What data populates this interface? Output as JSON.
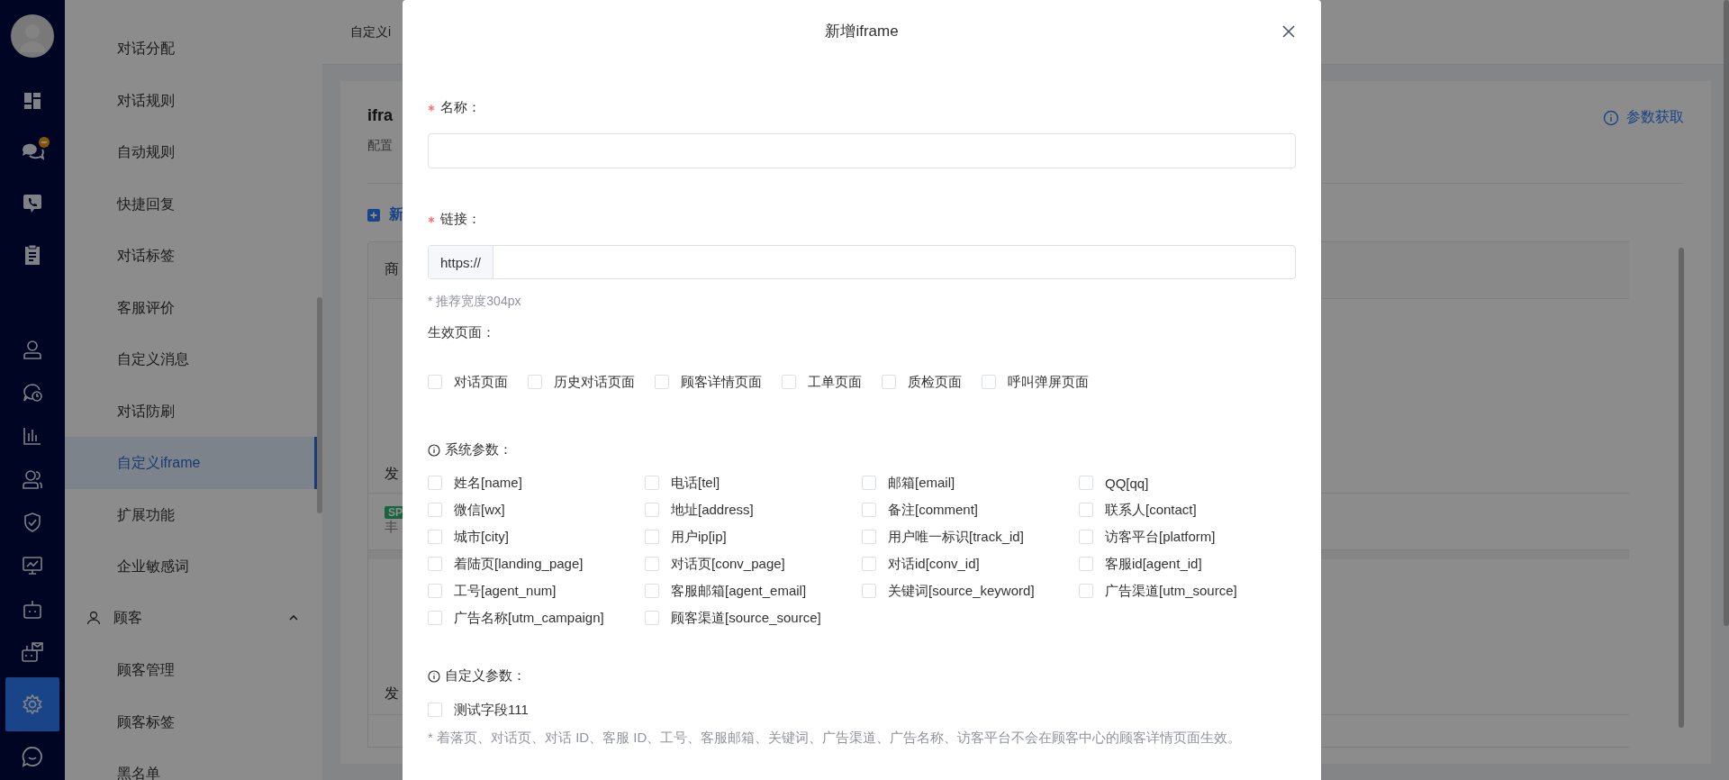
{
  "nav": {
    "top": [
      {
        "kind": "dashboard",
        "selected": false,
        "badge": false
      },
      {
        "kind": "chat",
        "selected": false,
        "badge": true
      },
      {
        "kind": "phone-chat",
        "selected": false,
        "badge": false
      },
      {
        "kind": "clipboard",
        "selected": false,
        "badge": false
      }
    ],
    "bottom": [
      {
        "kind": "user",
        "selected": false,
        "badge": false
      },
      {
        "kind": "chat-clock",
        "selected": false,
        "badge": false
      },
      {
        "kind": "bar-chart",
        "selected": false,
        "badge": false
      },
      {
        "kind": "users",
        "selected": false,
        "badge": false
      },
      {
        "kind": "shield",
        "selected": false,
        "badge": false
      },
      {
        "kind": "monitor",
        "selected": false,
        "badge": false
      },
      {
        "kind": "robot",
        "selected": false,
        "badge": false
      },
      {
        "kind": "robot-mail",
        "selected": false,
        "badge": false
      },
      {
        "kind": "settings",
        "selected": true,
        "badge": false
      },
      {
        "kind": "chat-bubble",
        "selected": false,
        "badge": false
      }
    ]
  },
  "menu": [
    {
      "kind": "item",
      "label": "对话分配",
      "selected": false
    },
    {
      "kind": "item",
      "label": "对话规则",
      "selected": false
    },
    {
      "kind": "item",
      "label": "自动规则",
      "selected": false
    },
    {
      "kind": "item",
      "label": "快捷回复",
      "selected": false
    },
    {
      "kind": "item",
      "label": "对话标签",
      "selected": false
    },
    {
      "kind": "item",
      "label": "客服评价",
      "selected": false
    },
    {
      "kind": "item",
      "label": "自定义消息",
      "selected": false
    },
    {
      "kind": "item",
      "label": "对话防刷",
      "selected": false
    },
    {
      "kind": "item",
      "label": "自定义iframe",
      "selected": true
    },
    {
      "kind": "item",
      "label": "扩展功能",
      "selected": false
    },
    {
      "kind": "item",
      "label": "企业敏感词",
      "selected": false
    },
    {
      "kind": "group",
      "label": "顾客",
      "expanded": true,
      "children": [
        {
          "kind": "item",
          "label": "顾客管理",
          "selected": false
        },
        {
          "kind": "item",
          "label": "顾客标签",
          "selected": false
        },
        {
          "kind": "item",
          "label": "黑名单",
          "selected": false
        }
      ]
    }
  ],
  "page": {
    "breadcrumb": "自定义i",
    "title": "ifra",
    "description": "配置",
    "add_button": "新",
    "params_link": "参数获取",
    "table": {
      "header": "商",
      "row_1": "发",
      "tag": "SP",
      "row_2": "丰",
      "row_3": "发"
    }
  },
  "dialog": {
    "title": "新增iframe",
    "fields": [
      {
        "kind": "text",
        "label": "名称：",
        "required": true
      },
      {
        "kind": "url",
        "label": "链接：",
        "required": true,
        "prefix": "https://",
        "hint": "* 推荐宽度304px"
      }
    ],
    "pages": {
      "label": "生效页面：",
      "options": [
        {
          "label": "对话页面",
          "checked": false
        },
        {
          "label": "历史对话页面",
          "checked": false
        },
        {
          "label": "顾客详情页面",
          "checked": false
        },
        {
          "label": "工单页面",
          "checked": false
        },
        {
          "label": "质检页面",
          "checked": false
        },
        {
          "label": "呼叫弹屏页面",
          "checked": false
        }
      ]
    },
    "system_params": {
      "label": "系统参数：",
      "options": [
        {
          "label": "姓名[name]",
          "checked": false
        },
        {
          "label": "电话[tel]",
          "checked": false
        },
        {
          "label": "邮箱[email]",
          "checked": false
        },
        {
          "label": "QQ[qq]",
          "checked": false
        },
        {
          "label": "微信[wx]",
          "checked": false
        },
        {
          "label": "地址[address]",
          "checked": false
        },
        {
          "label": "备注[comment]",
          "checked": false
        },
        {
          "label": "联系人[contact]",
          "checked": false
        },
        {
          "label": "城市[city]",
          "checked": false
        },
        {
          "label": "用户ip[ip]",
          "checked": false
        },
        {
          "label": "用户唯一标识[track_id]",
          "checked": false
        },
        {
          "label": "访客平台[platform]",
          "checked": false
        },
        {
          "label": "着陆页[landing_page]",
          "checked": false
        },
        {
          "label": "对话页[conv_page]",
          "checked": false
        },
        {
          "label": "对话id[conv_id]",
          "checked": false
        },
        {
          "label": "客服id[agent_id]",
          "checked": false
        },
        {
          "label": "工号[agent_num]",
          "checked": false
        },
        {
          "label": "客服邮箱[agent_email]",
          "checked": false
        },
        {
          "label": "关键词[source_keyword]",
          "checked": false
        },
        {
          "label": "广告渠道[utm_source]",
          "checked": false
        },
        {
          "label": "广告名称[utm_campaign]",
          "checked": false
        },
        {
          "label": "顾客渠道[source_source]",
          "checked": false
        }
      ]
    },
    "custom_params": {
      "label": "自定义参数：",
      "options": [
        {
          "label": "测试字段111",
          "checked": false
        }
      ]
    },
    "note": "* 着落页、对话页、对话 ID、客服 ID、工号、客服邮箱、关键词、广告渠道、广告名称、访客平台不会在顾客中心的顾客详情页面生效。"
  }
}
